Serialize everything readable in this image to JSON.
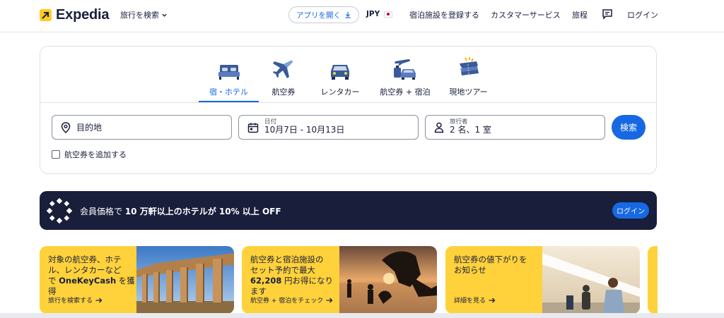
{
  "header": {
    "logo_text": "Expedia",
    "trip_search": "旅行を検索",
    "app_button": "アプリを開く",
    "currency": "JPY",
    "list_property": "宿泊施設を登録する",
    "support": "カスタマーサービス",
    "trips": "旅程",
    "login": "ログイン"
  },
  "tabs": [
    {
      "label": "宿・ホテル",
      "icon": "bed-icon",
      "active": true
    },
    {
      "label": "航空券",
      "icon": "airplane-icon"
    },
    {
      "label": "レンタカー",
      "icon": "car-icon"
    },
    {
      "label": "航空券 + 宿泊",
      "icon": "flight-hotel-icon"
    },
    {
      "label": "現地ツアー",
      "icon": "ticket-icon"
    }
  ],
  "search": {
    "destination_placeholder": "目的地",
    "dates_label": "日付",
    "dates_value": "10月7日 - 10月13日",
    "travelers_label": "旅行者",
    "travelers_value": "2 名、1 室",
    "search_button": "検索",
    "add_flight": "航空券を追加する"
  },
  "banner": {
    "text_1": "会員価格で ",
    "text_2": "10 万軒以上のホテルが ",
    "text_3": "10% 以上 OFF",
    "login": "ログイン"
  },
  "promos": [
    {
      "line1": "対象の航空券、ホテ",
      "line2": "ル、レンタカーなど",
      "line3a": "で ",
      "line3b": "OneKeyCash",
      "line3c": " を獲",
      "line4": "得",
      "link": "旅行を検索する"
    },
    {
      "line1": "航空券と宿泊施設の",
      "line2": "セット予約で最大",
      "line3a": "",
      "line3b": "62,208",
      "line3c": " 円お得になり",
      "line4": "ます",
      "link": "航空券 + 宿泊をチェック"
    },
    {
      "line1": "航空券の値下がりを",
      "line2": "お知らせ",
      "link": "詳細を見る"
    }
  ],
  "colors": {
    "brand_blue": "#1668e3",
    "navy": "#191e3b",
    "yellow": "#ffd23b",
    "logo_yellow": "#ffcc1f"
  }
}
